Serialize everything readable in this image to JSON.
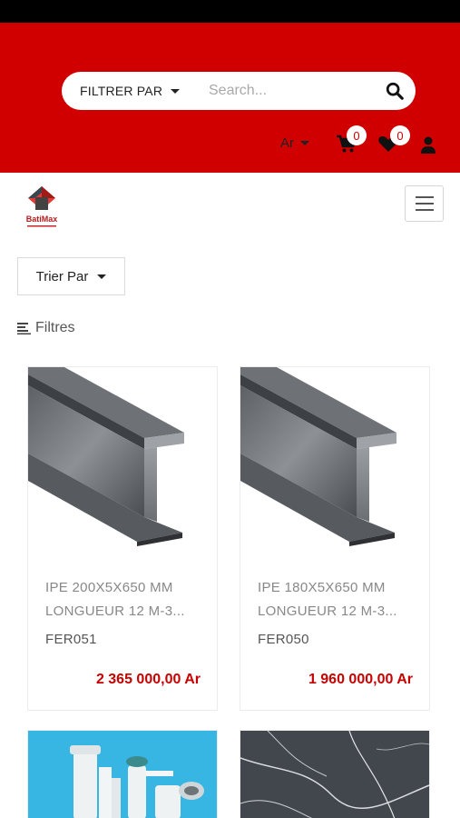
{
  "header": {
    "filter_label": "FILTRER PAR",
    "search_placeholder": "Search...",
    "currency": "Ar",
    "cart_count": "0",
    "wishlist_count": "0"
  },
  "colors": {
    "brand_red": "#d10000",
    "price_red": "#c70000"
  },
  "nav": {
    "logo_text": "BatiMax"
  },
  "toolbar": {
    "sort_label": "Trier Par",
    "filters_label": "Filtres"
  },
  "products": [
    {
      "name_line1": "IPE 200X5X650 MM",
      "name_line2": "LONGUEUR 12 M-3...",
      "ref": "FER051",
      "price": "2 365 000,00 Ar"
    },
    {
      "name_line1": "IPE 180X5X650 MM",
      "name_line2": "LONGUEUR 12 M-3...",
      "ref": "FER050",
      "price": "1 960 000,00 Ar"
    }
  ]
}
